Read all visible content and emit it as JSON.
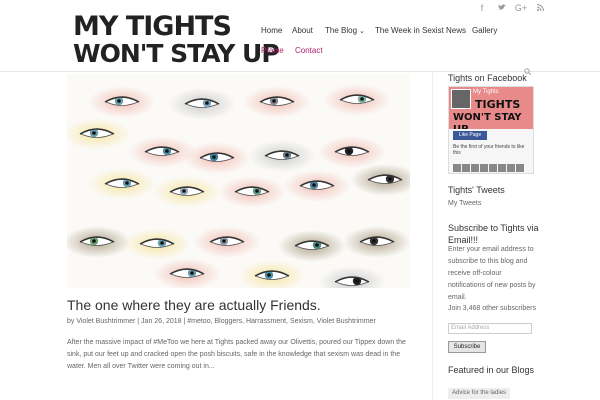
{
  "site": {
    "logo_line1": "MY TIGHTS",
    "logo_line2": "WON'T STAY UP"
  },
  "social": [
    "f",
    "t",
    "G+",
    "rss"
  ],
  "nav": {
    "items": [
      {
        "label": "Home"
      },
      {
        "label": "About"
      },
      {
        "label": "The Blog"
      },
      {
        "label": "The Week in Sexist News"
      },
      {
        "label": "Gallery"
      },
      {
        "label": "Praise"
      },
      {
        "label": "Contact"
      }
    ]
  },
  "post": {
    "title": "The one where they are actually Friends.",
    "meta": "by Violet Bushtrimmer | Jan 26, 2018 | #metoo, Bloggers, Harrassment, Sexism, Violet Bushtrimmer",
    "excerpt": "After the massive impact of #MeToo we here at Tights packed away our Olivettis, poured our Tippex down the sink, put our feet up and cracked open the posh biscuits, safe in the knowledge that sexism was dead in the water. Men all over Twitter were coming out in..."
  },
  "sidebar": {
    "fb_heading": "Tights on Facebook",
    "fb_page_name": "My Tights",
    "fb_cover_line1": "TIGHTS",
    "fb_cover_line2": "WON'T STAY UP",
    "fb_like": "Like Page",
    "fb_note": "Be the first of your friends to like this",
    "tweets_heading": "Tights' Tweets",
    "tweets_link": "My Tweets",
    "subscribe_heading": "Subscribe to Tights via Email!!!",
    "subscribe_text": "Enter your email address to subscribe to this blog and receive off-colour notifications of new posts by email.",
    "subscribers": "Join 3,468 other subscribers",
    "email_placeholder": "Email Address",
    "subscribe_button": "Subscribe",
    "featured_heading": "Featured in our Blogs",
    "featured_tag": "Advice for the ladies"
  },
  "colors": {
    "accent_pink": "#b0226e",
    "nav_text": "#333333",
    "fb_blue": "#3b5998"
  }
}
